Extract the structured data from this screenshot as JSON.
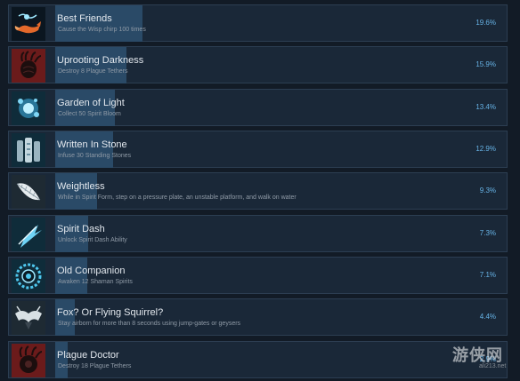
{
  "achievements": [
    {
      "title": "Best Friends",
      "description": "Cause the Wisp chirp 100 times",
      "percent": "19.6%",
      "percent_value": 19.6,
      "icon": "fox-wisp-icon"
    },
    {
      "title": "Uprooting Darkness",
      "description": "Destroy 8 Plague Tethers",
      "percent": "15.9%",
      "percent_value": 15.9,
      "icon": "plague-tether-icon"
    },
    {
      "title": "Garden of Light",
      "description": "Collect 50 Spirit Bloom",
      "percent": "13.4%",
      "percent_value": 13.4,
      "icon": "spirit-bloom-icon"
    },
    {
      "title": "Written In Stone",
      "description": "Infuse 30 Standing Stones",
      "percent": "12.9%",
      "percent_value": 12.9,
      "icon": "standing-stones-icon"
    },
    {
      "title": "Weightless",
      "description": "While in Spirit Form, step on a pressure plate, an unstable platform, and walk on water",
      "percent": "9.3%",
      "percent_value": 9.3,
      "icon": "feather-icon"
    },
    {
      "title": "Spirit Dash",
      "description": "Unlock Spirit Dash Ability",
      "percent": "7.3%",
      "percent_value": 7.3,
      "icon": "spirit-dash-icon"
    },
    {
      "title": "Old Companion",
      "description": "Awaken 12 Shaman Spirits",
      "percent": "7.1%",
      "percent_value": 7.1,
      "icon": "shaman-spirit-icon"
    },
    {
      "title": "Fox? Or Flying Squirrel?",
      "description": "Stay airborn for more than 8 seconds using jump-gates or geysers",
      "percent": "4.4%",
      "percent_value": 4.4,
      "icon": "flying-fox-icon"
    },
    {
      "title": "Plague Doctor",
      "description": "Destroy 18 Plague Tethers",
      "percent": "2.9%",
      "percent_value": 2.9,
      "icon": "plague-doctor-icon"
    }
  ],
  "watermark": {
    "text": "游侠网",
    "url": "ali213.net"
  },
  "colors": {
    "background": "#121b26",
    "row": "#1a2838",
    "bar": "#2a4a67",
    "percent_text": "#67b3e6",
    "icon_red_bg": "#6b1b1b",
    "icon_teal_bg": "#0f2c3a"
  }
}
